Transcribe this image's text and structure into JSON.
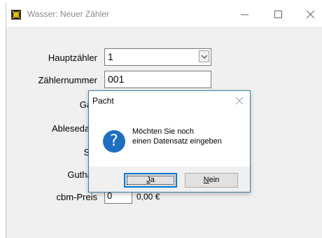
{
  "window": {
    "title": "Wasser: Neuer Zähler"
  },
  "form": {
    "hauptzaehler_label": "Hauptzähler",
    "hauptzaehler_value": "1",
    "zaehlernummer_label": "Zählernummer",
    "zaehlernummer_value": "001",
    "garten_label_visible": "Gart",
    "ablesedatum_label_visible": "Ablesedatu",
    "stand_label_visible": "Sta",
    "guthaben_label_visible": "Guthab",
    "cbm_preis_label_visible": "cbm-Preis",
    "cbm_preis_value_visible": "0",
    "cbm_preis_suffix_visible": "0,00 €"
  },
  "dialog": {
    "title": "Pacht",
    "message_line1": "Möchten Sie noch",
    "message_line2": "einen Datensatz eingeben",
    "icon": "question-icon",
    "yes_label_underlined": "J",
    "yes_label_rest": "a",
    "no_label_underlined": "N",
    "no_label_rest": "ein"
  },
  "colors": {
    "dialog_border": "#3c7fb1",
    "question_icon": "#1f6fc1",
    "default_button_border": "#0078d7"
  }
}
